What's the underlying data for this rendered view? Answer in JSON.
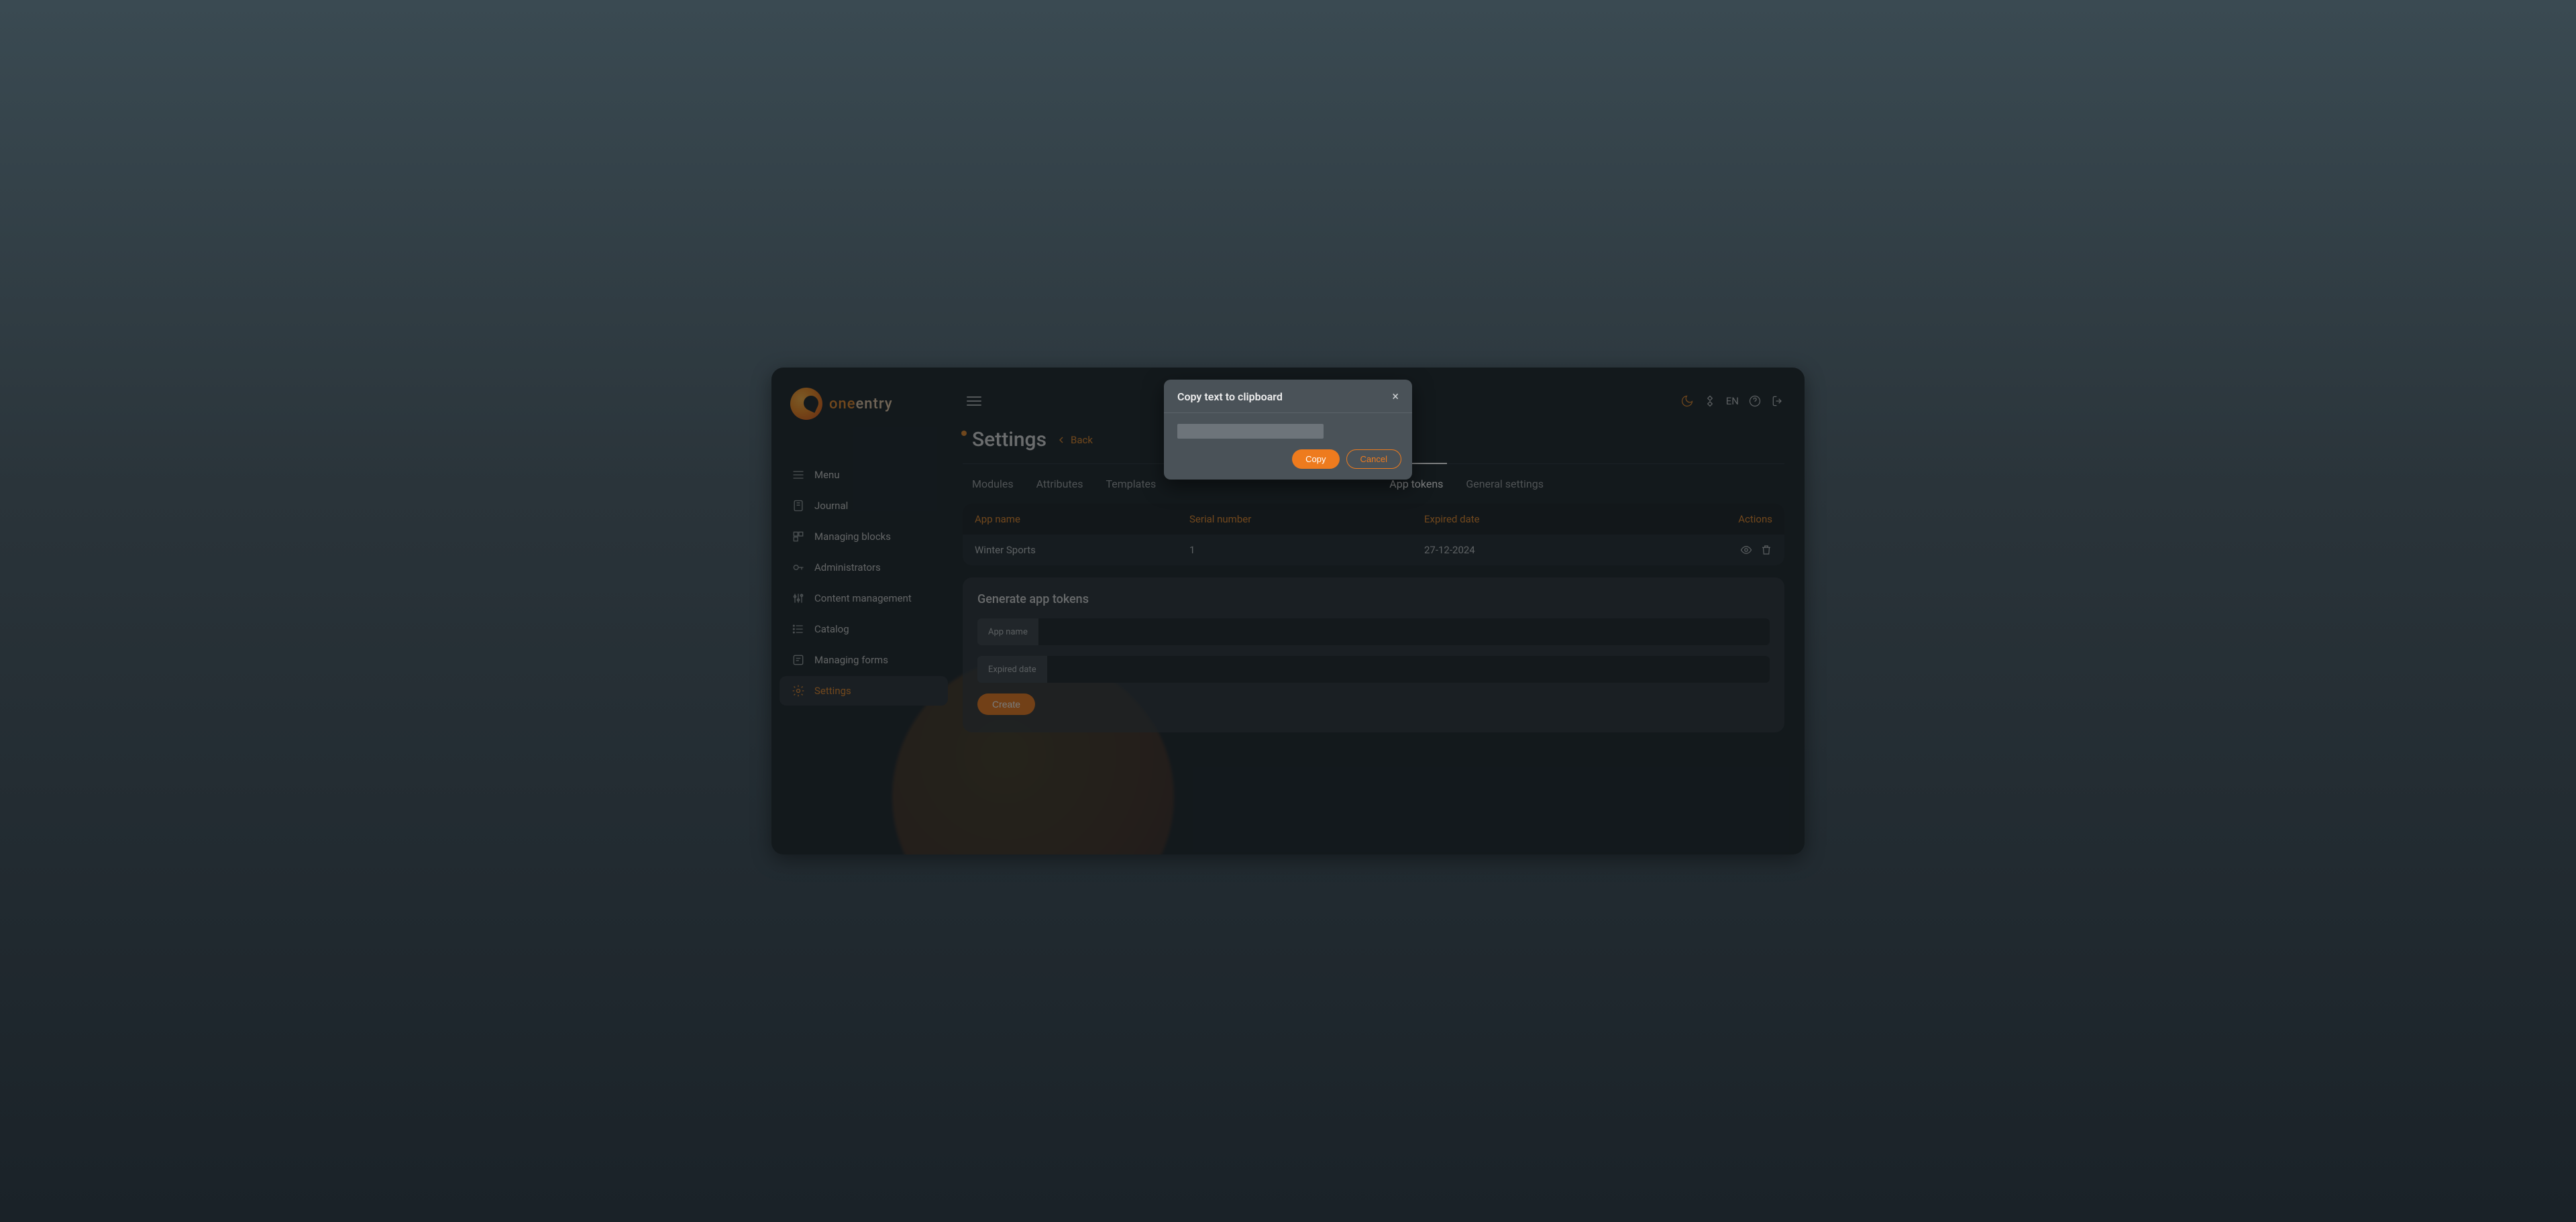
{
  "brand": {
    "name1": "one",
    "name2": "entry"
  },
  "sidebar": {
    "items": [
      {
        "label": "Menu",
        "icon": "menu"
      },
      {
        "label": "Journal",
        "icon": "journal"
      },
      {
        "label": "Managing blocks",
        "icon": "blocks"
      },
      {
        "label": "Administrators",
        "icon": "key"
      },
      {
        "label": "Content management",
        "icon": "sliders"
      },
      {
        "label": "Catalog",
        "icon": "list"
      },
      {
        "label": "Managing forms",
        "icon": "forms"
      },
      {
        "label": "Settings",
        "icon": "gear"
      }
    ],
    "active_index": 7
  },
  "header": {
    "title": "Settings",
    "back_label": "Back",
    "lang": "EN"
  },
  "tabs": [
    "Modules",
    "Attributes",
    "Templates",
    "App tokens",
    "General settings"
  ],
  "tabs_active_index": 3,
  "table": {
    "columns": {
      "c0": "App name",
      "c1": "Serial number",
      "c2": "Expired date",
      "c3": "Actions"
    },
    "rows": [
      {
        "app": "Winter Sports",
        "serial": "1",
        "expired": "27-12-2024"
      }
    ]
  },
  "generate": {
    "title": "Generate app tokens",
    "app_name_label": "App name",
    "expired_label": "Expired date",
    "create_label": "Create",
    "app_name_value": "",
    "expired_value": ""
  },
  "modal": {
    "title": "Copy text to clipboard",
    "value": "",
    "copy_label": "Copy",
    "cancel_label": "Cancel"
  }
}
